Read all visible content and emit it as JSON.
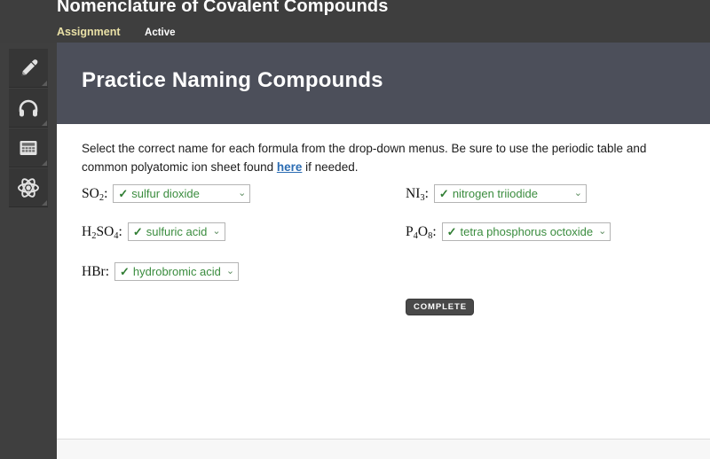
{
  "header": {
    "title": "Nomenclature of Covalent Compounds",
    "assignment_label": "Assignment",
    "status_label": "Active"
  },
  "sidebar": {
    "items": [
      {
        "name": "highlighter-tool",
        "icon": "pencil-icon"
      },
      {
        "name": "audio-tool",
        "icon": "headphones-icon"
      },
      {
        "name": "calculator-tool",
        "icon": "calculator-icon"
      },
      {
        "name": "periodic-table-tool",
        "icon": "atom-icon"
      }
    ]
  },
  "banner": {
    "title": "Practice Naming Compounds"
  },
  "instructions": {
    "part1": "Select the correct name for each formula from the drop-down menus. Be sure to use the periodic table and common polyatomic ion sheet found ",
    "link": "here",
    "part2": " if needed."
  },
  "questions": {
    "left": [
      {
        "formula_main": "SO",
        "formula_sub": "2",
        "formula_tail": ":",
        "answer": "sulfur dioxide",
        "check": "✓",
        "caret": "⌄"
      },
      {
        "formula_parts": "H2SO4",
        "formula_tail": ":",
        "answer": "sulfuric acid",
        "check": "✓",
        "caret": "⌄"
      },
      {
        "formula_parts": "HBr",
        "formula_tail": ":",
        "answer": "hydrobromic acid",
        "check": "✓",
        "caret": "⌄"
      }
    ],
    "right": [
      {
        "formula_main": "NI",
        "formula_sub": "3",
        "formula_tail": ":",
        "answer": "nitrogen triiodide",
        "check": "✓",
        "caret": "⌄"
      },
      {
        "formula_parts": "P4O8",
        "formula_tail": ":",
        "answer": "tetra phosphorus octoxide",
        "check": "✓",
        "caret": "⌄"
      }
    ]
  },
  "complete_button": {
    "label": "COMPLETE"
  },
  "colors": {
    "header_bg": "#3e3e3e",
    "banner_bg": "#4c4f5a",
    "answer_green": "#3a8c3e",
    "link_blue": "#2b6cb3",
    "assignment_yellow": "#e9e0a6"
  }
}
